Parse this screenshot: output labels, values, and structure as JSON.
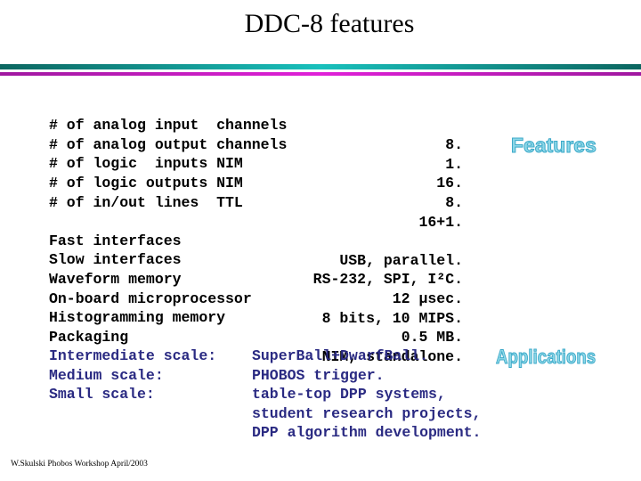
{
  "title": "DDC-8 features",
  "channels": [
    {
      "label": "# of analog input  channels",
      "value": "8."
    },
    {
      "label": "# of analog output channels",
      "value": "1."
    },
    {
      "label": "# of logic  inputs NIM",
      "value": "16."
    },
    {
      "label": "# of logic outputs NIM",
      "value": "8."
    },
    {
      "label": "# of in/out lines  TTL",
      "value": "16+1."
    }
  ],
  "specs": [
    {
      "label": "Fast interfaces",
      "value": "USB, parallel."
    },
    {
      "label": "Slow interfaces",
      "value": "RS-232, SPI, I²C."
    },
    {
      "label": "Waveform memory",
      "value": "12 μsec."
    },
    {
      "label": "On-board microprocessor",
      "value": "8 bits, 10 MIPS."
    },
    {
      "label": "Histogramming memory",
      "value": "0.5 MB."
    },
    {
      "label": "Packaging",
      "value": "NIM, standalone."
    }
  ],
  "applications": [
    {
      "label": "Intermediate scale:",
      "value": "SuperBall+DwarfBall."
    },
    {
      "label": "Medium scale:",
      "value": "PHOBOS trigger."
    },
    {
      "label": "Small scale:",
      "value": "table-top DPP systems,"
    },
    {
      "label": "",
      "value": "student research projects,"
    },
    {
      "label": "",
      "value": "DPP algorithm development."
    }
  ],
  "wordart": {
    "features": "Features",
    "applications": "Applications"
  },
  "footer": "W.Skulski  Phobos Workshop April/2003",
  "colors": {
    "bar_teal": "#18c0bc",
    "bar_magenta": "#e020d8",
    "applications_text": "#2a2a82",
    "wordart_fill": "#8ed8e8"
  }
}
